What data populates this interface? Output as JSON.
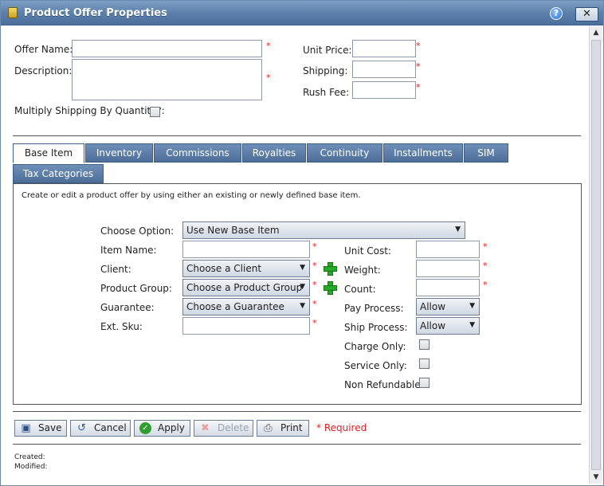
{
  "window": {
    "title": "Product Offer Properties",
    "help": "?",
    "close": "✕"
  },
  "header": {
    "offer_name_label": "Offer Name:",
    "offer_name_value": "",
    "description_label": "Description:",
    "description_value": "",
    "multiply_label": "Multiply Shipping By Quantity?:",
    "multiply_checked": false,
    "unit_price_label": "Unit Price:",
    "shipping_label": "Shipping:",
    "rush_fee_label": "Rush Fee:",
    "required_mark": "*"
  },
  "tabs": [
    {
      "label": "Base Item",
      "active": true
    },
    {
      "label": "Inventory"
    },
    {
      "label": "Commissions"
    },
    {
      "label": "Royalties"
    },
    {
      "label": "Continuity"
    },
    {
      "label": "Installments"
    },
    {
      "label": "SIM"
    },
    {
      "label": "Tax Categories"
    }
  ],
  "base_item": {
    "description": "Create or edit a product offer by using either an existing or newly defined base item.",
    "choose_option_label": "Choose Option:",
    "choose_option_value": "Use New Base Item",
    "item_name_label": "Item Name:",
    "client_label": "Client:",
    "client_value": "Choose a Client",
    "product_group_label": "Product Group:",
    "product_group_value": "Choose a Product Group",
    "guarantee_label": "Guarantee:",
    "guarantee_value": "Choose a Guarantee",
    "ext_sku_label": "Ext. Sku:",
    "unit_cost_label": "Unit Cost:",
    "weight_label": "Weight:",
    "count_label": "Count:",
    "pay_process_label": "Pay Process:",
    "pay_process_value": "Allow",
    "ship_process_label": "Ship Process:",
    "ship_process_value": "Allow",
    "charge_only_label": "Charge Only:",
    "service_only_label": "Service Only:",
    "non_refundable_label": "Non Refundable:"
  },
  "toolbar": {
    "save": "Save",
    "cancel": "Cancel",
    "apply": "Apply",
    "delete": "Delete",
    "print": "Print",
    "required_note": "* Required"
  },
  "footer": {
    "created_label": "Created:",
    "modified_label": "Modified:"
  },
  "icons": {
    "title": "product-box-icon",
    "help": "help-icon",
    "close": "close-icon",
    "add": "plus-icon",
    "save": "floppy-disk-icon",
    "cancel": "undo-icon",
    "apply": "check-icon",
    "delete": "x-icon",
    "print": "printer-icon"
  },
  "colors": {
    "titlebar": "#5a7ea9",
    "tab": "#5a7aa4",
    "required": "#e02020",
    "plus": "#2aa82a"
  }
}
